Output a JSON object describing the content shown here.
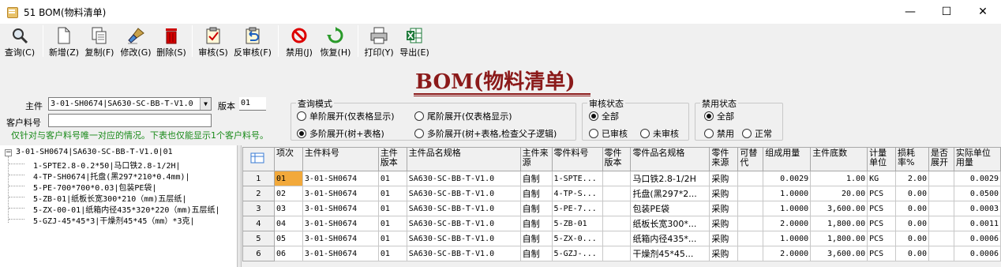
{
  "window": {
    "title": "51 BOM(物料清单)",
    "min_glyph": "—",
    "max_glyph": "☐",
    "close_glyph": "✕"
  },
  "toolbar": [
    {
      "name": "query-button",
      "label": "查询(C)",
      "icon": "magnifier-icon"
    },
    {
      "name": "new-button",
      "label": "新增(Z)",
      "icon": "new-doc-icon"
    },
    {
      "name": "copy-button",
      "label": "复制(F)",
      "icon": "copy-icon"
    },
    {
      "name": "edit-button",
      "label": "修改(G)",
      "icon": "edit-brush-icon"
    },
    {
      "name": "delete-button",
      "label": "删除(S)",
      "icon": "trash-icon"
    },
    {
      "name": "audit-button",
      "label": "审核(S)",
      "icon": "audit-check-icon"
    },
    {
      "name": "unaudit-button",
      "label": "反审核(F)",
      "icon": "unaudit-icon"
    },
    {
      "name": "disable-button",
      "label": "禁用(J)",
      "icon": "forbidden-icon"
    },
    {
      "name": "restore-button",
      "label": "恢复(H)",
      "icon": "recycle-icon"
    },
    {
      "name": "print-button",
      "label": "打印(Y)",
      "icon": "printer-icon"
    },
    {
      "name": "export-button",
      "label": "导出(E)",
      "icon": "excel-icon"
    }
  ],
  "heading": "BOM(物料清单)",
  "filters": {
    "main_label": "主件",
    "main_value": "3-01-SH0674|SA630-SC-BB-T-V1.0",
    "version_label": "版本",
    "version_value": "01",
    "customer_label": "客户料号",
    "customer_value": "",
    "note": "仅针对与客户料号唯一对应的情况。下表也仅能显示1个客户料号。"
  },
  "query_mode": {
    "title": "查询模式",
    "options": [
      "单阶展开(仅表格显示)",
      "尾阶展开(仅表格显示)",
      "多阶展开(树+表格)",
      "多阶展开(树+表格,检查父子逻辑)"
    ],
    "selected": 2
  },
  "audit_status": {
    "title": "审核状态",
    "options": [
      "全部",
      "已审核",
      "未审核"
    ],
    "selected": 0
  },
  "disable_status": {
    "title": "禁用状态",
    "options": [
      "全部",
      "禁用",
      "正常"
    ],
    "selected": 0
  },
  "tree": {
    "toggle": "−",
    "root": "3-01-SH0674|SA630-SC-BB-T-V1.0|01",
    "children": [
      "1-SPTE2.8-0.2*50|马口铁2.8-1/2H|",
      "4-TP-SH0674|托盘(黑297*210*0.4mm)|",
      "5-PE-700*700*0.03|包装PE袋|",
      "5-ZB-01|纸板长宽300*210（mm)五层纸|",
      "5-ZX-00-01|纸箱内径435*320*220（mm)五层纸|",
      "5-GZJ-45*45*3|干燥剂45*45（mm）*3克|"
    ]
  },
  "grid": {
    "columns": [
      "项次",
      "主件料号",
      "主件版本",
      "主件品名规格",
      "主件来源",
      "零件料号",
      "零件版本",
      "零件品名规格",
      "零件来源",
      "可替代",
      "组成用量",
      "主件底数",
      "计量单位",
      "损耗率%",
      "是否展开",
      "实际单位用量"
    ],
    "rows": [
      [
        "1",
        "01",
        "3-01-SH0674",
        "01",
        "SA630-SC-BB-T-V1.0",
        "自制",
        "1-SPTE...",
        "",
        "马口铁2.8-1/2H",
        "采购",
        "",
        "0.0029",
        "1.00",
        "KG",
        "2.00",
        "",
        "0.0029"
      ],
      [
        "2",
        "02",
        "3-01-SH0674",
        "01",
        "SA630-SC-BB-T-V1.0",
        "自制",
        "4-TP-S...",
        "",
        "托盘(黑297*2...",
        "采购",
        "",
        "1.0000",
        "20.00",
        "PCS",
        "0.00",
        "",
        "0.0500"
      ],
      [
        "3",
        "03",
        "3-01-SH0674",
        "01",
        "SA630-SC-BB-T-V1.0",
        "自制",
        "5-PE-7...",
        "",
        "包装PE袋",
        "采购",
        "",
        "1.0000",
        "3,600.00",
        "PCS",
        "0.00",
        "",
        "0.0003"
      ],
      [
        "4",
        "04",
        "3-01-SH0674",
        "01",
        "SA630-SC-BB-T-V1.0",
        "自制",
        "5-ZB-01",
        "",
        "纸板长宽300*...",
        "采购",
        "",
        "2.0000",
        "1,800.00",
        "PCS",
        "0.00",
        "",
        "0.0011"
      ],
      [
        "5",
        "05",
        "3-01-SH0674",
        "01",
        "SA630-SC-BB-T-V1.0",
        "自制",
        "5-ZX-0...",
        "",
        "纸箱内径435*...",
        "采购",
        "",
        "1.0000",
        "1,800.00",
        "PCS",
        "0.00",
        "",
        "0.0006"
      ],
      [
        "6",
        "06",
        "3-01-SH0674",
        "01",
        "SA630-SC-BB-T-V1.0",
        "自制",
        "5-GZJ-...",
        "",
        "干燥剂45*45...",
        "采购",
        "",
        "2.0000",
        "3,600.00",
        "PCS",
        "0.00",
        "",
        "0.0006"
      ]
    ]
  }
}
